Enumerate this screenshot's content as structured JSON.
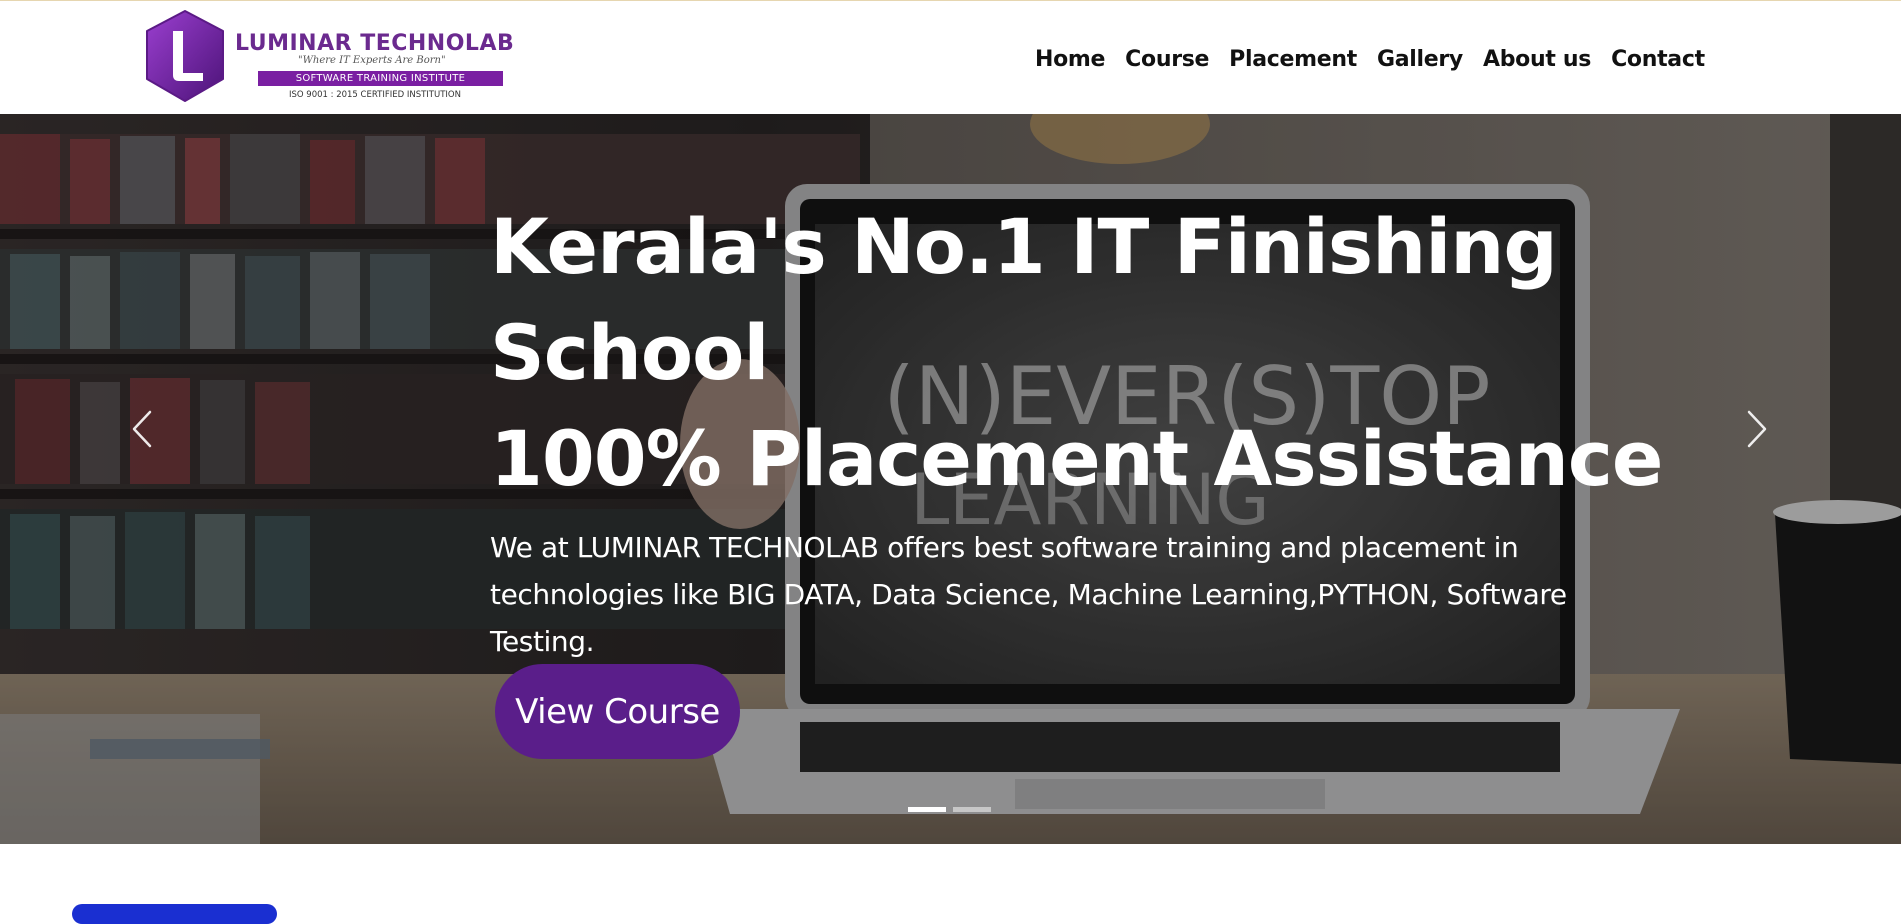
{
  "brand": {
    "name": "LUMINAR TECHNOLAB",
    "tagline": "\"Where IT Experts Are Born\"",
    "strip": "SOFTWARE TRAINING INSTITUTE",
    "certification": "ISO 9001 : 2015 CERTIFIED INSTITUTION",
    "badge_letter": "L",
    "colors": {
      "primary": "#6b2a8f",
      "strip": "#7a1fa2"
    }
  },
  "nav": {
    "items": [
      {
        "label": "Home"
      },
      {
        "label": "Course"
      },
      {
        "label": "Placement"
      },
      {
        "label": "Gallery"
      },
      {
        "label": "About us"
      },
      {
        "label": "Contact"
      }
    ]
  },
  "hero": {
    "title_line1": "Kerala's No.1 IT Finishing",
    "title_line2": "School",
    "title_line3": "100% Placement Assistance",
    "description": "We at LUMINAR TECHNOLAB offers best software training and placement in technologies like BIG DATA, Data Science, Machine Learning,PYTHON, Software Testing.",
    "cta_label": "View Course",
    "cta_color": "#5a1e8a",
    "background_chalk_text": "(N)EVER(S)TOP LEARNING",
    "prev_icon": "chevron-left-icon",
    "next_icon": "chevron-right-icon",
    "slides": {
      "count": 2,
      "active": 1
    }
  }
}
